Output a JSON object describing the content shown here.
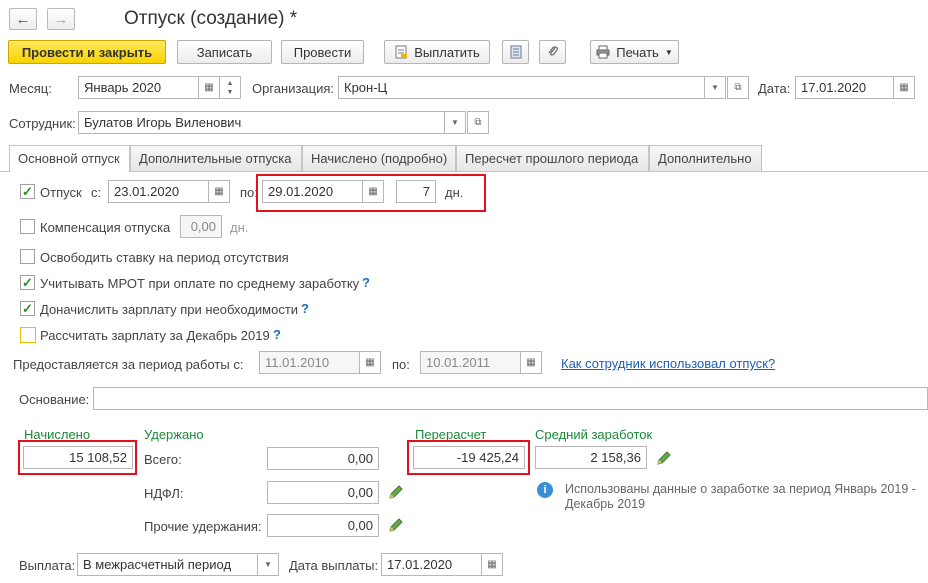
{
  "nav": {
    "back_glyph": "←",
    "forward_glyph": "→"
  },
  "header": {
    "title": "Отпуск (создание) *"
  },
  "toolbar": {
    "post_close": "Провести и закрыть",
    "save": "Записать",
    "post": "Провести",
    "pay": "Выплатить",
    "print": "Печать"
  },
  "form": {
    "month_label": "Месяц:",
    "month_value": "Январь 2020",
    "org_label": "Организация:",
    "org_value": "Крон-Ц",
    "date_label": "Дата:",
    "date_value": "17.01.2020",
    "employee_label": "Сотрудник:",
    "employee_value": "Булатов Игорь Виленович"
  },
  "tabs": [
    {
      "label": "Основной отпуск"
    },
    {
      "label": "Дополнительные отпуска"
    },
    {
      "label": "Начислено (подробно)"
    },
    {
      "label": "Пересчет прошлого периода"
    },
    {
      "label": "Дополнительно"
    }
  ],
  "vacation": {
    "label": "Отпуск",
    "from_label": "с:",
    "from_value": "23.01.2020",
    "to_label": "по:",
    "to_value": "29.01.2020",
    "days_value": "7",
    "days_unit": "дн.",
    "checked": true
  },
  "compensation": {
    "label": "Компенсация отпуска",
    "value": "0,00",
    "unit": "дн.",
    "checked": false
  },
  "options": [
    {
      "label": "Освободить ставку на период отсутствия",
      "checked": false,
      "help": ""
    },
    {
      "label": "Учитывать МРОТ при оплате по среднему заработку",
      "checked": true,
      "help": "?"
    },
    {
      "label": "Доначислить зарплату при необходимости",
      "checked": true,
      "help": "?"
    },
    {
      "label": "Рассчитать зарплату за Декабрь 2019",
      "checked": false,
      "help": "?"
    }
  ],
  "period": {
    "label": "Предоставляется за период работы с:",
    "from_value": "11.01.2010",
    "to_label": "по:",
    "to_value": "10.01.2011",
    "link": "Как сотрудник использовал отпуск?"
  },
  "basis": {
    "label": "Основание:",
    "value": ""
  },
  "accrued": {
    "label": "Начислено",
    "value": "15 108,52"
  },
  "withheld": {
    "label": "Удержано",
    "total_label": "Всего:",
    "total_value": "0,00",
    "ndfl_label": "НДФЛ:",
    "ndfl_value": "0,00",
    "other_label": "Прочие удержания:",
    "other_value": "0,00"
  },
  "recalc": {
    "label": "Перерасчет",
    "value": "-19 425,24"
  },
  "avg_earnings": {
    "label": "Средний заработок",
    "value": "2 158,36"
  },
  "info": {
    "text_line1": "Использованы данные о заработке за период Январь 2019 -",
    "text_line2": "Декабрь 2019"
  },
  "payout": {
    "label": "Выплата:",
    "value": "В межрасчетный период",
    "date_label": "Дата выплаты:",
    "date_value": "17.01.2020"
  },
  "colors": {
    "accent_yellow": "#f8d300",
    "highlight_red": "#e3101e",
    "green_label": "#1a8a3a",
    "link_blue": "#1f5fb3"
  }
}
